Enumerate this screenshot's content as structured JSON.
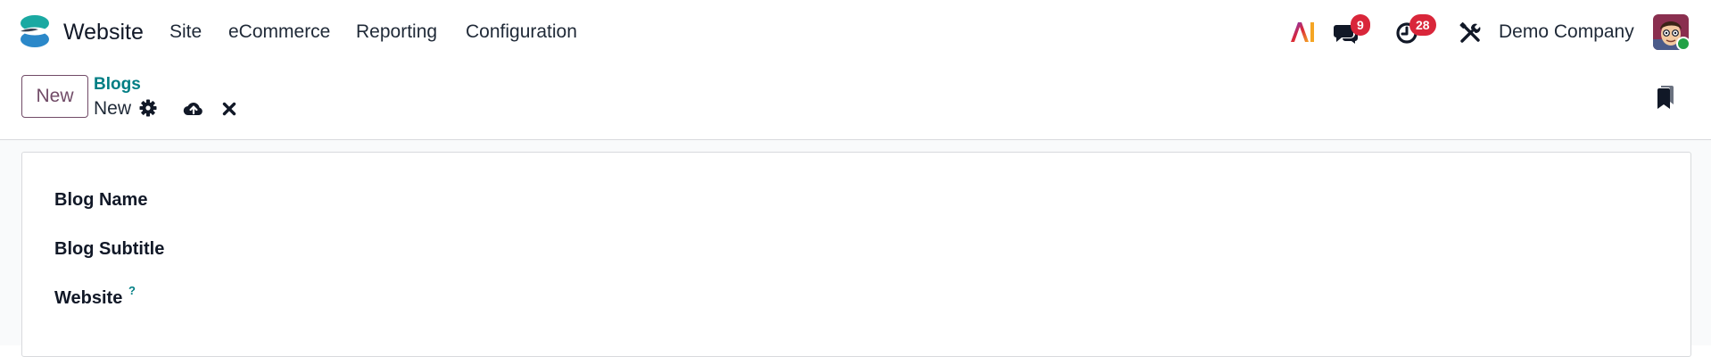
{
  "app": {
    "name": "Website",
    "logo_icon": "odoo-website-logo-icon"
  },
  "menu": {
    "items": [
      {
        "label": "Site"
      },
      {
        "label": "eCommerce"
      },
      {
        "label": "Reporting"
      },
      {
        "label": "Configuration"
      }
    ]
  },
  "systray": {
    "ai_icon": "ai-icon",
    "messages_icon": "chat-bubbles-icon",
    "messages_count": "9",
    "activities_icon": "clock-icon",
    "activities_count": "28",
    "debug_icon": "tools-icon",
    "company": "Demo Company",
    "avatar_icon": "user-avatar"
  },
  "control_panel": {
    "new_label": "New",
    "breadcrumb_parent": "Blogs",
    "record_name": "New",
    "settings_icon": "gear-icon",
    "save_icon": "cloud-upload-icon",
    "discard_icon": "close-icon",
    "bookmark_icon": "bookmarks-icon"
  },
  "form": {
    "fields": [
      {
        "label": "Blog Name"
      },
      {
        "label": "Blog Subtitle"
      },
      {
        "label": "Website",
        "help": "?"
      }
    ]
  },
  "colors": {
    "brand": "#714b67",
    "link": "#017e84",
    "badge": "#d9263a",
    "online": "#22a146"
  }
}
